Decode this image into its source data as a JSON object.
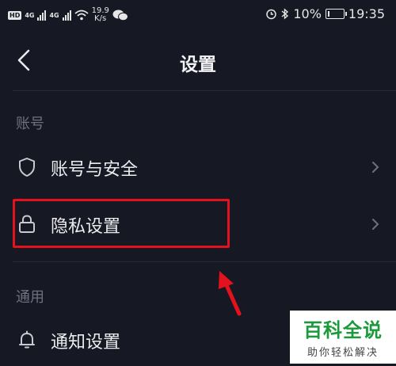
{
  "status_bar": {
    "badge": "HD",
    "net1": "4G",
    "net2": "4G",
    "speed_value": "19.9",
    "speed_unit": "K/s",
    "battery": "10%",
    "battery_level": 0.1,
    "time": "19:35"
  },
  "header": {
    "title": "设置"
  },
  "sections": [
    {
      "title": "账号",
      "items": [
        {
          "label": "账号与安全",
          "icon": "shield-icon"
        },
        {
          "label": "隐私设置",
          "icon": "lock-icon"
        }
      ]
    },
    {
      "title": "通用",
      "items": [
        {
          "label": "通知设置",
          "icon": "bell-icon"
        }
      ]
    }
  ],
  "watermark": {
    "main": "百科全说",
    "sub": "助你轻松解决",
    "color": "#1a9a3a"
  },
  "colors": {
    "background": "#161823",
    "highlight": "#e3121c",
    "annotation_arrow": "#e3121c"
  }
}
